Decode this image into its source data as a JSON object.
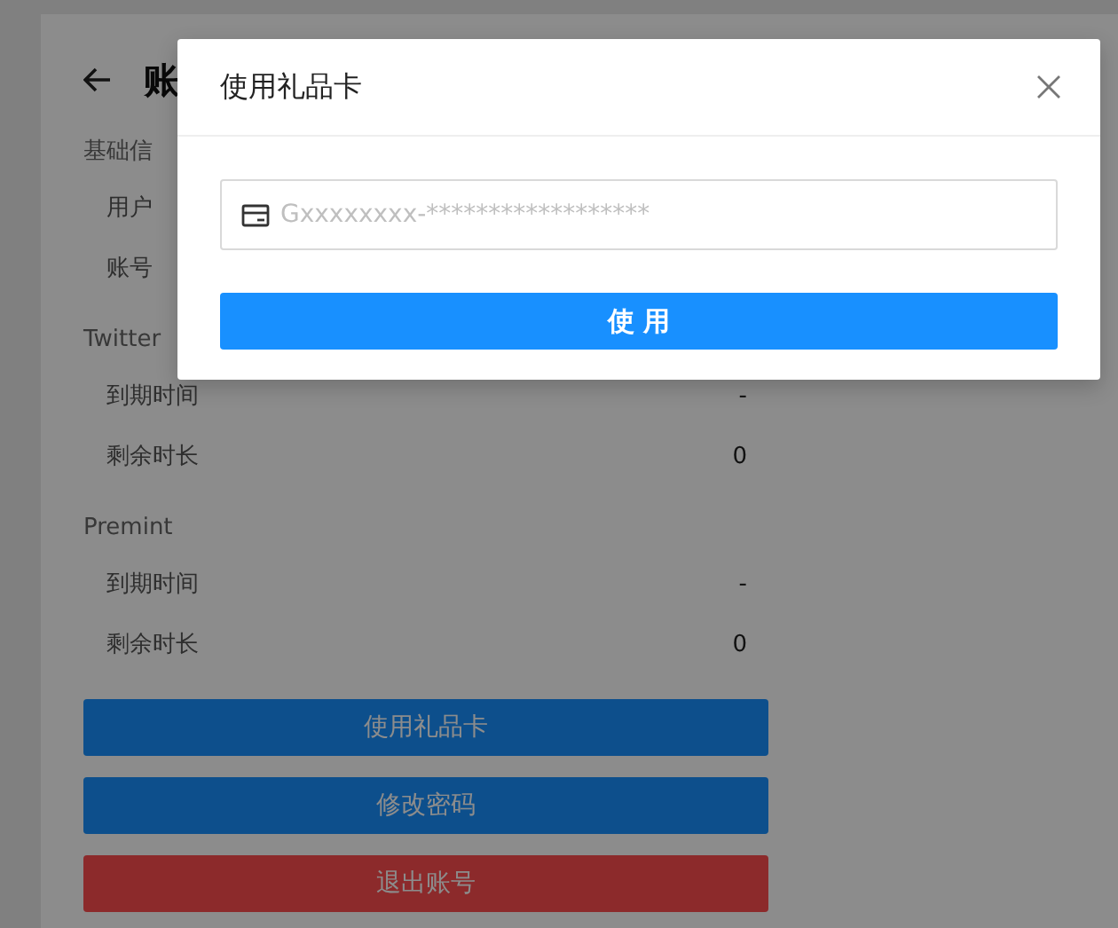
{
  "page": {
    "title": "账",
    "sections": [
      {
        "heading": "基础信",
        "rows": [
          {
            "label": "用户"
          },
          {
            "label": "账号"
          }
        ]
      },
      {
        "heading": "Twitter",
        "rows": [
          {
            "label": "到期时间",
            "value": "-"
          },
          {
            "label": "剩余时长",
            "value": "0"
          }
        ]
      },
      {
        "heading": "Premint",
        "rows": [
          {
            "label": "到期时间",
            "value": "-"
          },
          {
            "label": "剩余时长",
            "value": "0"
          }
        ]
      }
    ],
    "buttons": [
      {
        "label": "使用礼品卡",
        "kind": "primary"
      },
      {
        "label": "修改密码",
        "kind": "primary"
      },
      {
        "label": "退出账号",
        "kind": "danger"
      }
    ]
  },
  "dialog": {
    "title": "使用礼品卡",
    "input": {
      "placeholder": "Gxxxxxxxx-******************"
    },
    "button": "使 用"
  }
}
